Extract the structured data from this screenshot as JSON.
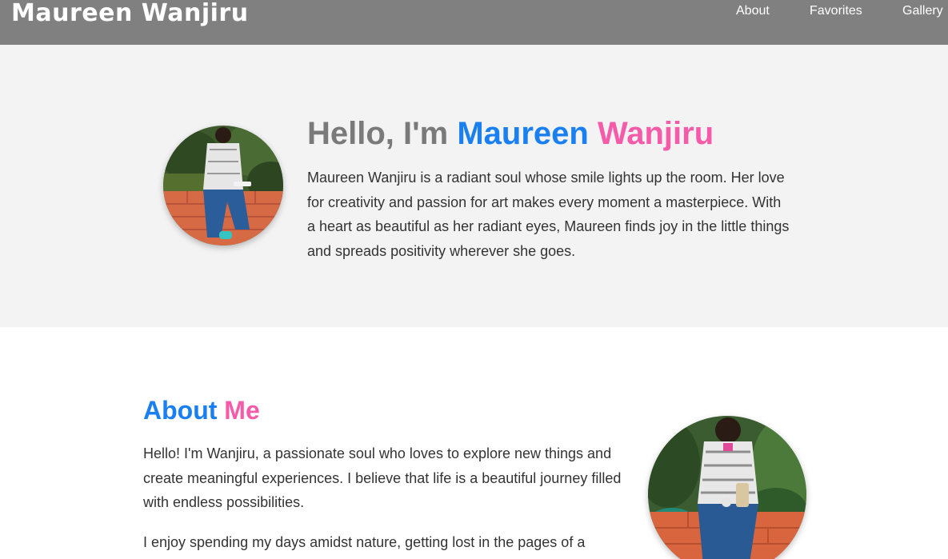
{
  "header": {
    "brand": "Maureen Wanjiru",
    "nav": {
      "about": "About",
      "favorites": "Favorites",
      "gallery": "Gallery"
    }
  },
  "hero": {
    "title_prefix": "Hello, I'm ",
    "title_first": "Maureen",
    "title_last": "Wanjiru",
    "bio": "Maureen Wanjiru is a radiant soul whose smile lights up the room. Her love for creativity and passion for art makes every moment a masterpiece. With a heart as beautiful as her radiant eyes, Maureen finds joy in the little things and spreads positivity wherever she goes."
  },
  "about": {
    "title_first": "About",
    "title_second": "Me",
    "paragraphs": [
      "Hello! I'm Wanjiru, a passionate soul who loves to explore new things and create meaningful experiences. I believe that life is a beautiful journey filled with endless possibilities.",
      "I enjoy spending my days amidst nature, getting lost in the pages of a"
    ]
  },
  "colors": {
    "navbar": "#808080",
    "hero_background": "#f3f3f3",
    "accent_blue": "#1a7ff0",
    "accent_pink": "#f55ba8",
    "title_gray": "#7a7a7a"
  }
}
